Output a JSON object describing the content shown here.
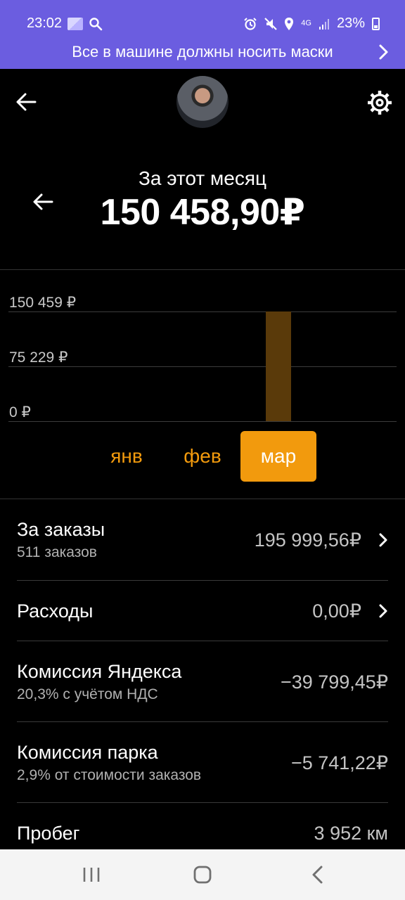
{
  "status_bar": {
    "time": "23:02",
    "network": "4G",
    "battery": "23%",
    "icons": [
      "gallery-icon",
      "search-icon",
      "alarm-icon",
      "mute-icon",
      "location-icon",
      "network-icon",
      "signal-icon",
      "battery-icon"
    ]
  },
  "banner": {
    "text": "Все в машине должны носить маски"
  },
  "header": {
    "period_label": "За этот месяц",
    "amount": "150 458,90₽"
  },
  "chart_data": {
    "type": "bar",
    "categories": [
      "янв",
      "фев",
      "мар"
    ],
    "values": [
      0,
      0,
      150458.9
    ],
    "y_tick_labels": [
      "150 459 ₽",
      "75 229 ₽",
      "0 ₽"
    ],
    "ylim": [
      0,
      150459
    ],
    "bar_color": "#5a3a0a",
    "accent_color": "#f29a0d",
    "selected": "мар"
  },
  "rows": [
    {
      "title": "За заказы",
      "subtitle": "511 заказов",
      "value": "195 999,56₽",
      "has_chevron": true
    },
    {
      "title": "Расходы",
      "subtitle": "",
      "value": "0,00₽",
      "has_chevron": true
    },
    {
      "title": "Комиссия Яндекса",
      "subtitle": "20,3% с учётом НДС",
      "value": "−39 799,45₽",
      "has_chevron": false
    },
    {
      "title": "Комиссия парка",
      "subtitle": "2,9% от стоимости заказов",
      "value": "−5 741,22₽",
      "has_chevron": false
    },
    {
      "title": "Пробег",
      "subtitle": "",
      "value": "3 952 км",
      "has_chevron": false
    }
  ]
}
